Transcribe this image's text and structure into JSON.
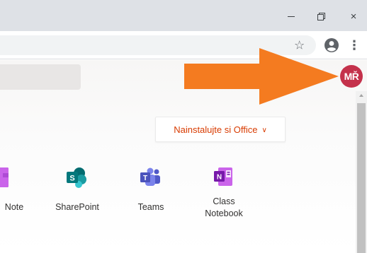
{
  "window": {
    "minimize_icon": "minimize-icon",
    "maximize_icon": "restore-icon",
    "close_glyph": "×"
  },
  "toolbar": {
    "bookmark_glyph": "☆",
    "profile_icon": "account-circle-icon",
    "menu_glyph": "⋮"
  },
  "header": {
    "avatar_initials": "MŘ",
    "avatar_color": "#c4314b"
  },
  "main": {
    "install_button_label": "Nainstalujte si Office",
    "install_chevron": "∨",
    "accent_color": "#d83b01",
    "apps": [
      {
        "label": "Note",
        "icon": "onenote-icon"
      },
      {
        "label": "SharePoint",
        "icon": "sharepoint-icon"
      },
      {
        "label": "Teams",
        "icon": "teams-icon"
      },
      {
        "label_line1": "Class",
        "label_line2": "Notebook",
        "icon": "class-notebook-icon"
      }
    ]
  },
  "overlay": {
    "arrow_color": "#f47b20"
  }
}
